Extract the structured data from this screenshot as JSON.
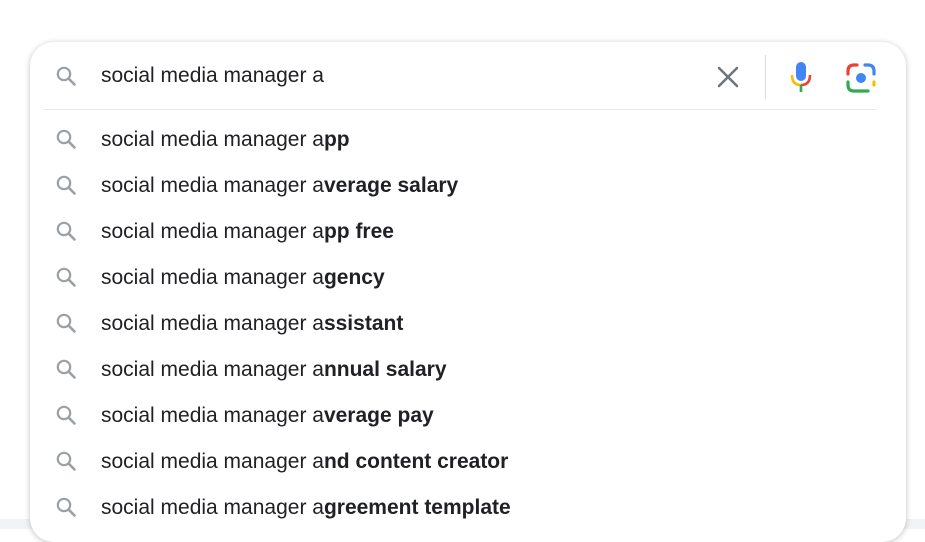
{
  "search": {
    "query": "social media manager a"
  },
  "colors": {
    "icon_gray": "#9aa0a6",
    "clear_gray": "#70757a",
    "text": "#202124",
    "google_blue": "#4285f4",
    "google_red": "#ea4335",
    "google_yellow": "#fbbc04",
    "google_green": "#34a853"
  },
  "icons": {
    "search": "search-icon",
    "clear": "close-icon",
    "voice": "microphone-icon",
    "lens": "google-lens-icon"
  },
  "suggestions": [
    {
      "prefix": "social media manager a",
      "completion": "pp"
    },
    {
      "prefix": "social media manager a",
      "completion": "verage salary"
    },
    {
      "prefix": "social media manager a",
      "completion": "pp free"
    },
    {
      "prefix": "social media manager a",
      "completion": "gency"
    },
    {
      "prefix": "social media manager a",
      "completion": "ssistant"
    },
    {
      "prefix": "social media manager a",
      "completion": "nnual salary"
    },
    {
      "prefix": "social media manager a",
      "completion": "verage pay"
    },
    {
      "prefix": "social media manager a",
      "completion": "nd content creator"
    },
    {
      "prefix": "social media manager a",
      "completion": "greement template"
    }
  ]
}
